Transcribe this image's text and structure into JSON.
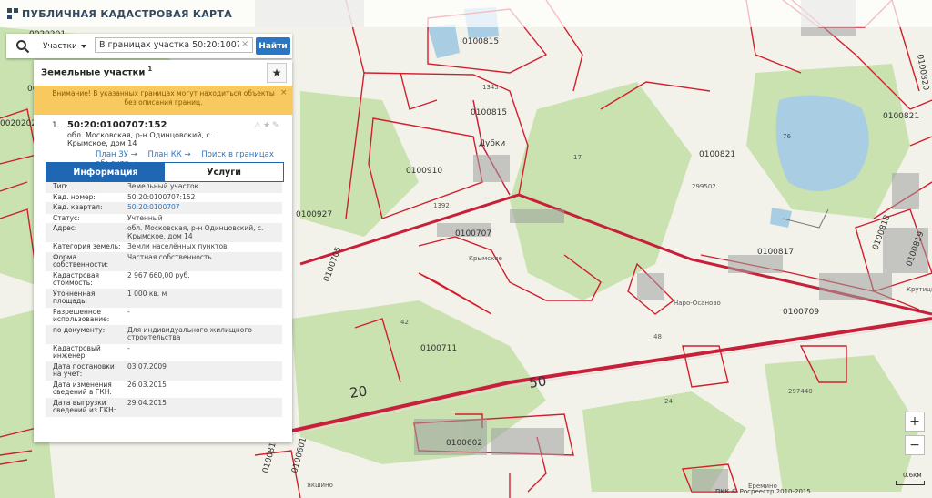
{
  "header": {
    "title": "ПУБЛИЧНАЯ КАДАСТРОВАЯ КАРТА"
  },
  "search": {
    "type_label": "Участки",
    "value": "В границах участка 50:20:10070",
    "button_label": "Найти",
    "clear_symbol": "×"
  },
  "result": {
    "title": "Земельные участки",
    "count": "1",
    "favorite_symbol": "★",
    "warning": "Внимание! В указанных границах могут находиться объекты без описания границ.",
    "warning_close": "×",
    "item": {
      "number": "1.",
      "cadnum": "50:20:0100707:152",
      "address": "обл. Московская, р-н Одинцовский, с. Крымское, дом 14",
      "tools": "⚠★✎",
      "links": [
        "План ЗУ →",
        "План КК →",
        "Поиск в границах объекта →"
      ]
    },
    "tabs": [
      {
        "label": "Информация",
        "active": true
      },
      {
        "label": "Услуги",
        "active": false
      }
    ],
    "info": [
      {
        "label": "Тип:",
        "value": "Земельный участок"
      },
      {
        "label": "Кад. номер:",
        "value": "50:20:0100707:152"
      },
      {
        "label": "Кад. квартал:",
        "value": "50:20:0100707",
        "link": true
      },
      {
        "label": "Статус:",
        "value": "Учтенный"
      },
      {
        "label": "Адрес:",
        "value": "обл. Московская, р-н Одинцовский, с. Крымское, дом 14"
      },
      {
        "label": "Категория земель:",
        "value": "Земли населённых пунктов"
      },
      {
        "label": "Форма собственности:",
        "value": "Частная собственность"
      },
      {
        "label": "Кадастровая стоимость:",
        "value": "2 967 660,00 руб."
      },
      {
        "label": "Уточненная площадь:",
        "value": "1 000 кв. м"
      },
      {
        "label": "Разрешенное использование:",
        "value": "-"
      },
      {
        "label": "по документу:",
        "value": "Для индивидуального жилищного строительства"
      },
      {
        "label": "Кадастровый инженер:",
        "value": "-"
      },
      {
        "label": "Дата постановки на учет:",
        "value": "03.07.2009"
      },
      {
        "label": "Дата изменения сведений в ГКН:",
        "value": "26.03.2015"
      },
      {
        "label": "Дата выгрузки сведений из ГКН:",
        "value": "29.04.2015"
      }
    ]
  },
  "map": {
    "labels": [
      {
        "text": "0020201",
        "cls": "lg"
      },
      {
        "text": "0020201",
        "cls": "lg"
      },
      {
        "text": "0020202",
        "cls": "lg"
      },
      {
        "text": "0100815",
        "cls": "lg"
      },
      {
        "text": "0100815",
        "cls": "lg"
      },
      {
        "text": "0100821",
        "cls": "lg"
      },
      {
        "text": "0100821",
        "cls": "lg"
      },
      {
        "text": "0100927",
        "cls": "lg"
      },
      {
        "text": "0100910",
        "cls": "lg"
      },
      {
        "text": "0100707",
        "cls": "lg"
      },
      {
        "text": "0100817",
        "cls": "lg"
      },
      {
        "text": "0100709",
        "cls": "lg"
      },
      {
        "text": "0100711",
        "cls": "lg"
      },
      {
        "text": "0100602",
        "cls": "lg"
      },
      {
        "text": "Дубки",
        "cls": "lg"
      },
      {
        "text": "Крымское",
        "cls": "sm"
      },
      {
        "text": "Наро-Осаново",
        "cls": "sm"
      },
      {
        "text": "1345",
        "cls": "sm"
      },
      {
        "text": "1392",
        "cls": "sm"
      },
      {
        "text": "17",
        "cls": "sm"
      },
      {
        "text": "76",
        "cls": "sm"
      },
      {
        "text": "299502",
        "cls": "sm"
      },
      {
        "text": "297440",
        "cls": "sm"
      },
      {
        "text": "24",
        "cls": "sm"
      },
      {
        "text": "42",
        "cls": "sm"
      },
      {
        "text": "48",
        "cls": "sm"
      },
      {
        "text": "50",
        "cls": "road"
      },
      {
        "text": "20",
        "cls": "road"
      },
      {
        "text": "0100705",
        "cls": "lg"
      },
      {
        "text": "0100601",
        "cls": "lg"
      },
      {
        "text": "0100818",
        "cls": "lg"
      },
      {
        "text": "0100819",
        "cls": "lg"
      },
      {
        "text": "0100820",
        "cls": "lg"
      },
      {
        "text": "0100819",
        "cls": "lg"
      },
      {
        "text": "Крутицы",
        "cls": "sm"
      },
      {
        "text": "Якшино",
        "cls": "sm"
      },
      {
        "text": "Еремино",
        "cls": "sm"
      }
    ]
  },
  "controls": {
    "zoom_in": "+",
    "zoom_out": "−",
    "scale_label": "0.6км",
    "copyright": "ПКК © Росреестр 2010-2015"
  },
  "colors": {
    "boundary": "#d11f2e",
    "road": "#c7203a",
    "water": "#a9cde3",
    "forest": "#c9e2b0",
    "field": "#f3f2ea"
  }
}
